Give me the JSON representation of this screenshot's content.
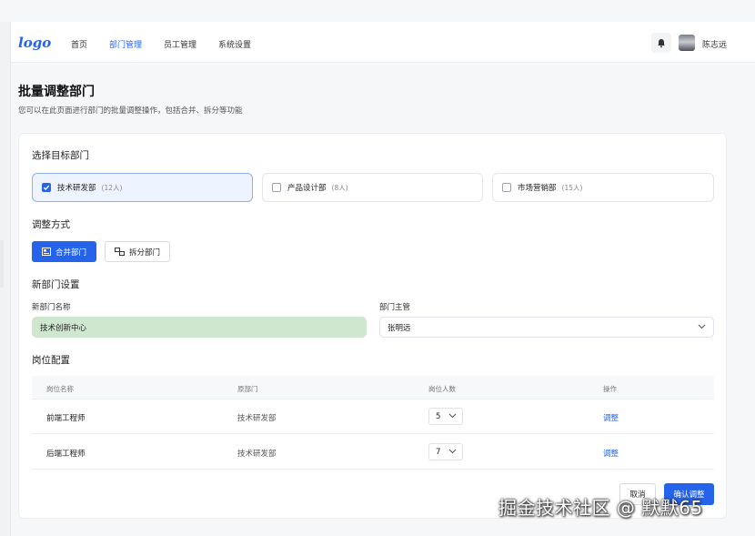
{
  "header": {
    "logo": "logo",
    "nav": [
      {
        "label": "首页",
        "active": false
      },
      {
        "label": "部门管理",
        "active": true
      },
      {
        "label": "员工管理",
        "active": false
      },
      {
        "label": "系统设置",
        "active": false
      }
    ],
    "user_name": "陈志远"
  },
  "page": {
    "title": "批量调整部门",
    "description": "您可以在此页面进行部门的批量调整操作，包括合并、拆分等功能"
  },
  "target_section": {
    "title": "选择目标部门",
    "departments": [
      {
        "name": "技术研发部",
        "count": "(12人)",
        "checked": true
      },
      {
        "name": "产品设计部",
        "count": "(8人)",
        "checked": false
      },
      {
        "name": "市场营销部",
        "count": "(15人)",
        "checked": false
      }
    ]
  },
  "method_section": {
    "title": "调整方式",
    "merge_label": "合并部门",
    "split_label": "拆分部门"
  },
  "new_dept_section": {
    "title": "新部门设置",
    "name_label": "新部门名称",
    "name_value": "技术创新中心",
    "manager_label": "部门主管",
    "manager_value": "张明远"
  },
  "positions_section": {
    "title": "岗位配置",
    "columns": [
      "岗位名称",
      "原部门",
      "岗位人数",
      "操作"
    ],
    "rows": [
      {
        "name": "前端工程师",
        "dept": "技术研发部",
        "count": "5",
        "action": "调整"
      },
      {
        "name": "后端工程师",
        "dept": "技术研发部",
        "count": "7",
        "action": "调整"
      }
    ]
  },
  "footer": {
    "cancel_label": "取消",
    "confirm_label": "确认调整"
  },
  "watermark": "掘金技术社区 @ 默默65",
  "colors": {
    "accent": "#2563eb",
    "name_field_bg": "#cfe6cf",
    "selected_card_bg": "#eef4ff"
  }
}
